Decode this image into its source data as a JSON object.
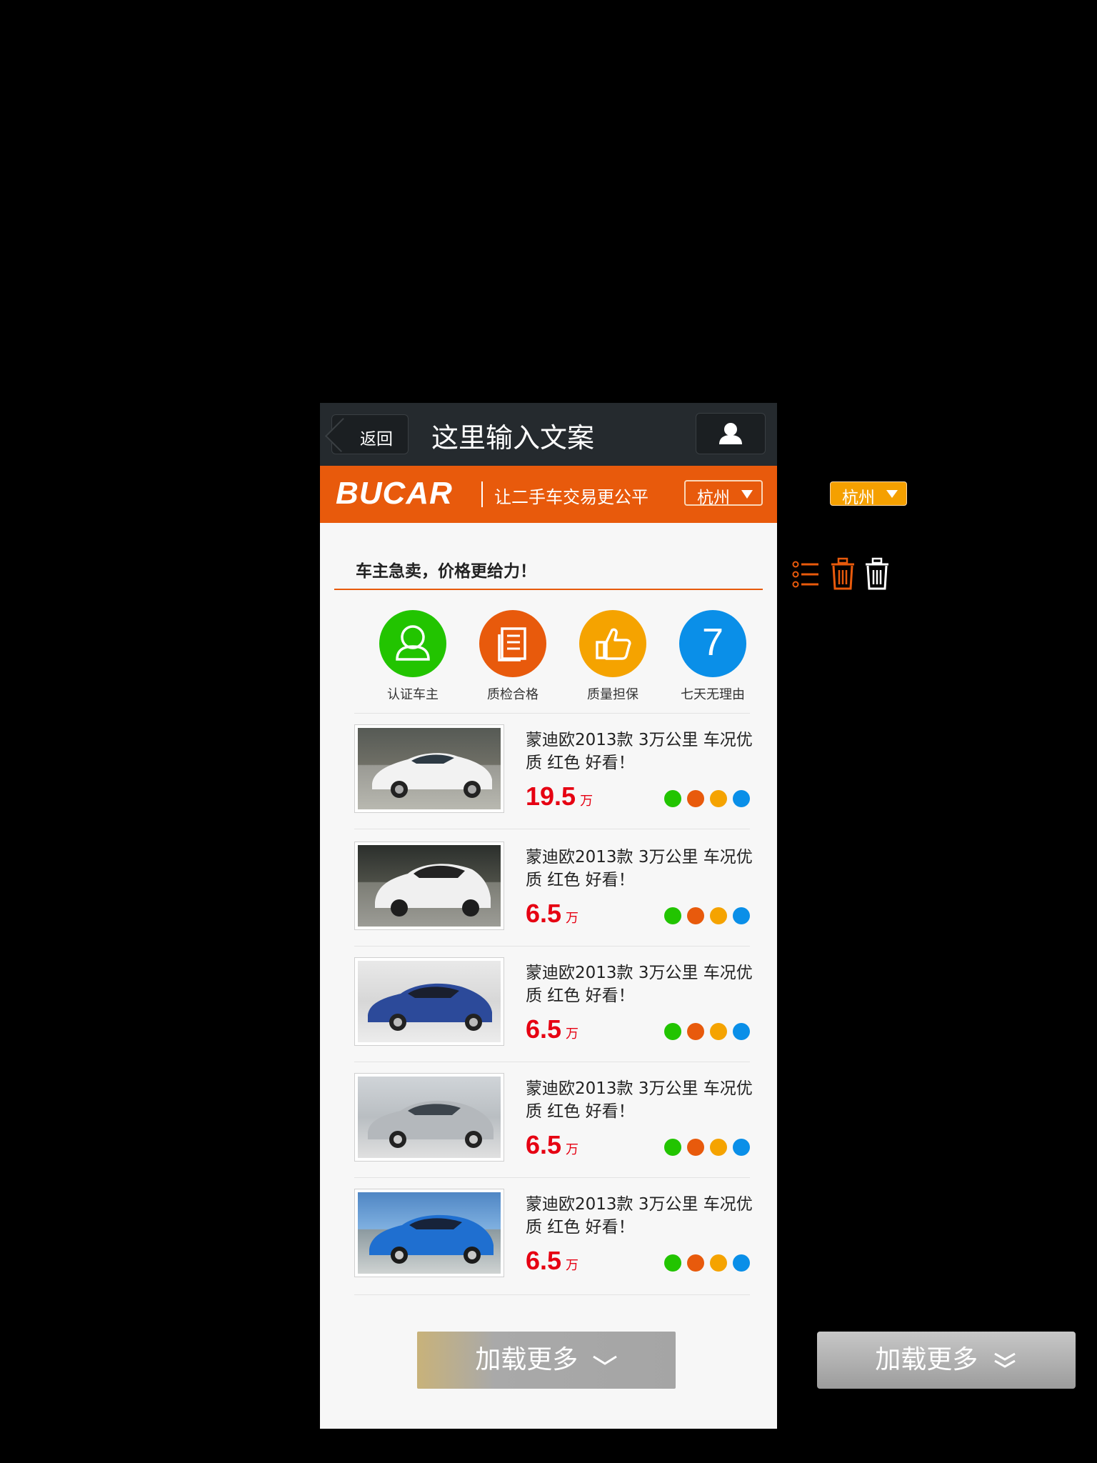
{
  "nav": {
    "back_label": "返回",
    "title": "这里输入文案"
  },
  "brand": {
    "logo": "BUCAR",
    "slogan": "让二手车交易更公平",
    "city": "杭州"
  },
  "section": {
    "title": "车主急卖，价格更给力！"
  },
  "features": [
    {
      "label": "认证车主",
      "icon": "certified-owner-icon",
      "color": "#22c400"
    },
    {
      "label": "质检合格",
      "icon": "inspection-icon",
      "color": "#e85a0c"
    },
    {
      "label": "质量担保",
      "icon": "thumbs-up-icon",
      "color": "#f5a300"
    },
    {
      "label": "七天无理由",
      "icon": "seven-day-icon",
      "color": "#0a8fe8",
      "glyph": "7"
    }
  ],
  "listings": [
    {
      "title": "蒙迪欧2013款 3万公里 车况优质 红色 好看！",
      "price": "19.5",
      "unit": "万"
    },
    {
      "title": "蒙迪欧2013款 3万公里 车况优质 红色 好看！",
      "price": "6.5",
      "unit": "万"
    },
    {
      "title": "蒙迪欧2013款 3万公里 车况优质 红色 好看！",
      "price": "6.5",
      "unit": "万"
    },
    {
      "title": "蒙迪欧2013款 3万公里 车况优质 红色 好看！",
      "price": "6.5",
      "unit": "万"
    },
    {
      "title": "蒙迪欧2013款 3万公里 车况优质 红色 好看！",
      "price": "6.5",
      "unit": "万"
    }
  ],
  "load_more": {
    "label": "加载更多"
  },
  "extras": {
    "city": "杭州",
    "load_more": "加载更多"
  },
  "colors": {
    "accent": "#e85a0c",
    "price": "#e60012",
    "nav_bg": "#252a2e"
  }
}
